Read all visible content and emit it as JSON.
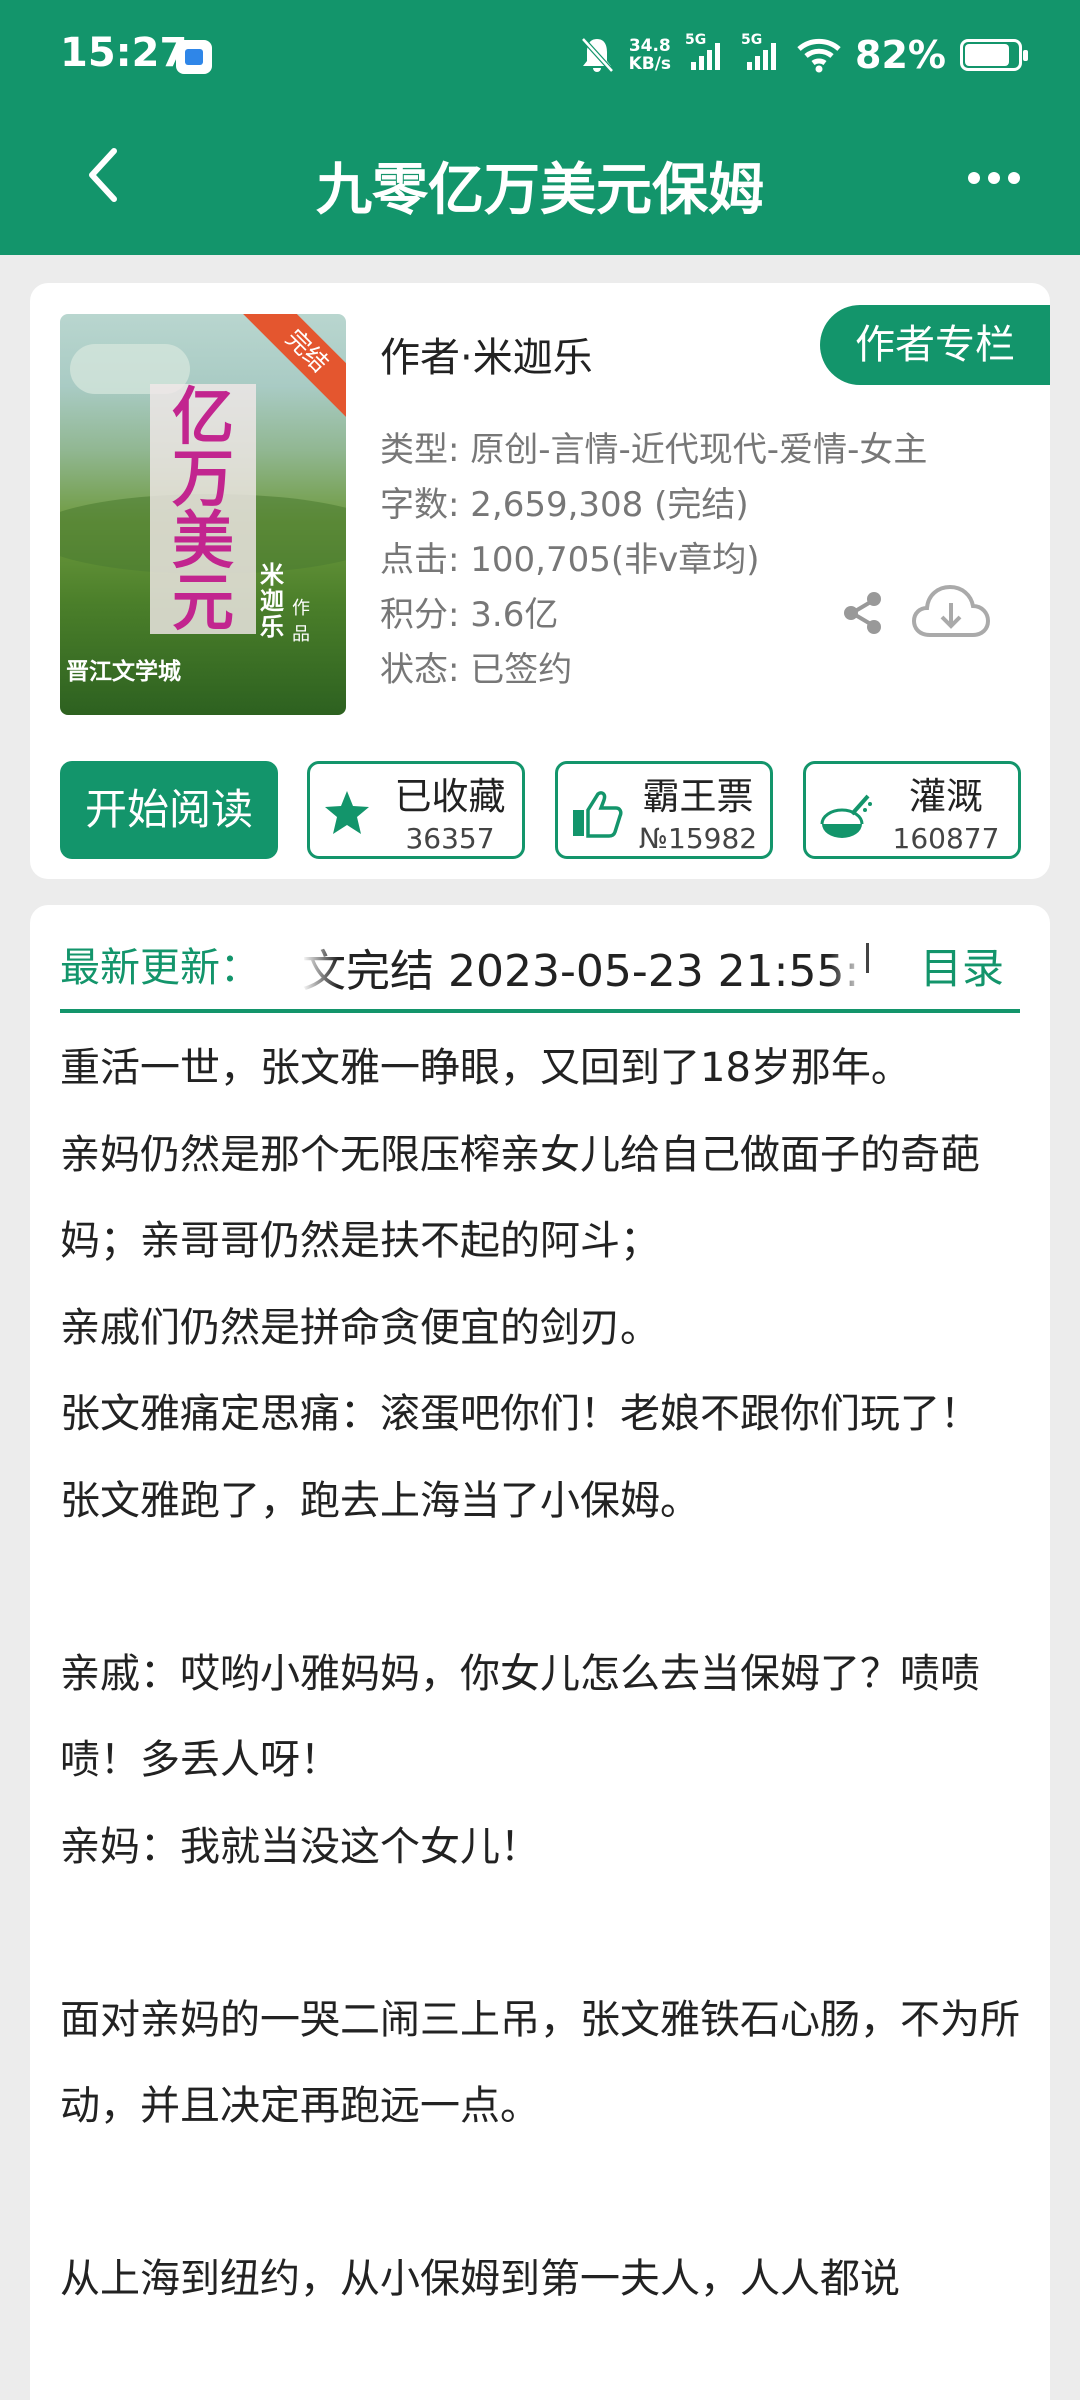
{
  "status_bar": {
    "time": "15:27",
    "net_speed_value": "34.8",
    "net_speed_unit": "KB/s",
    "sim1_label": "5G",
    "sim2_label": "5G",
    "battery": "82%"
  },
  "header": {
    "title": "九零亿万美元保姆",
    "back_icon": "chevron-left-icon",
    "more_icon": "more-dots-icon"
  },
  "book": {
    "cover": {
      "title_chars": [
        "亿",
        "万",
        "美",
        "元"
      ],
      "author_chars": "米迦乐",
      "works_label": "作品",
      "publisher": "晋江文学城",
      "ribbon": "完结"
    },
    "author_column_button": "作者专栏",
    "author_line": "作者·米迦乐",
    "meta": [
      "类型: 原创-言情-近代现代-爱情-女主",
      "字数: 2,659,308 (完结)",
      "点击: 100,705(非v章均)",
      "积分: 3.6亿",
      "状态: 已签约"
    ]
  },
  "actions": {
    "start_reading": "开始阅读",
    "favorite": {
      "label": "已收藏",
      "count": "36357"
    },
    "vote": {
      "label": "霸王票",
      "count": "№15982"
    },
    "water": {
      "label": "灌溉",
      "count": "160877"
    }
  },
  "latest": {
    "label": "最新更新：",
    "text": "文完结  2023-05-23 21:55:",
    "toc": "目录"
  },
  "description": [
    "重活一世，张文雅一睁眼，又回到了18岁那年。",
    "亲妈仍然是那个无限压榨亲女儿给自己做面子的奇葩妈；亲哥哥仍然是扶不起的阿斗；",
    "亲戚们仍然是拼命贪便宜的剑刃。",
    "张文雅痛定思痛：滚蛋吧你们！老娘不跟你们玩了！",
    "张文雅跑了，跑去上海当了小保姆。",
    "",
    "亲戚：哎哟小雅妈妈，你女儿怎么去当保姆了？啧啧啧！多丢人呀！",
    "亲妈：我就当没这个女儿！",
    "",
    "面对亲妈的一哭二闹三上吊，张文雅铁石心肠，不为所动，并且决定再跑远一点。",
    "",
    "从上海到纽约，从小保姆到第一夫人，人人都说"
  ],
  "colors": {
    "accent": "#13956b",
    "ribbon": "#e4562f",
    "cover_title": "#c2258f"
  }
}
